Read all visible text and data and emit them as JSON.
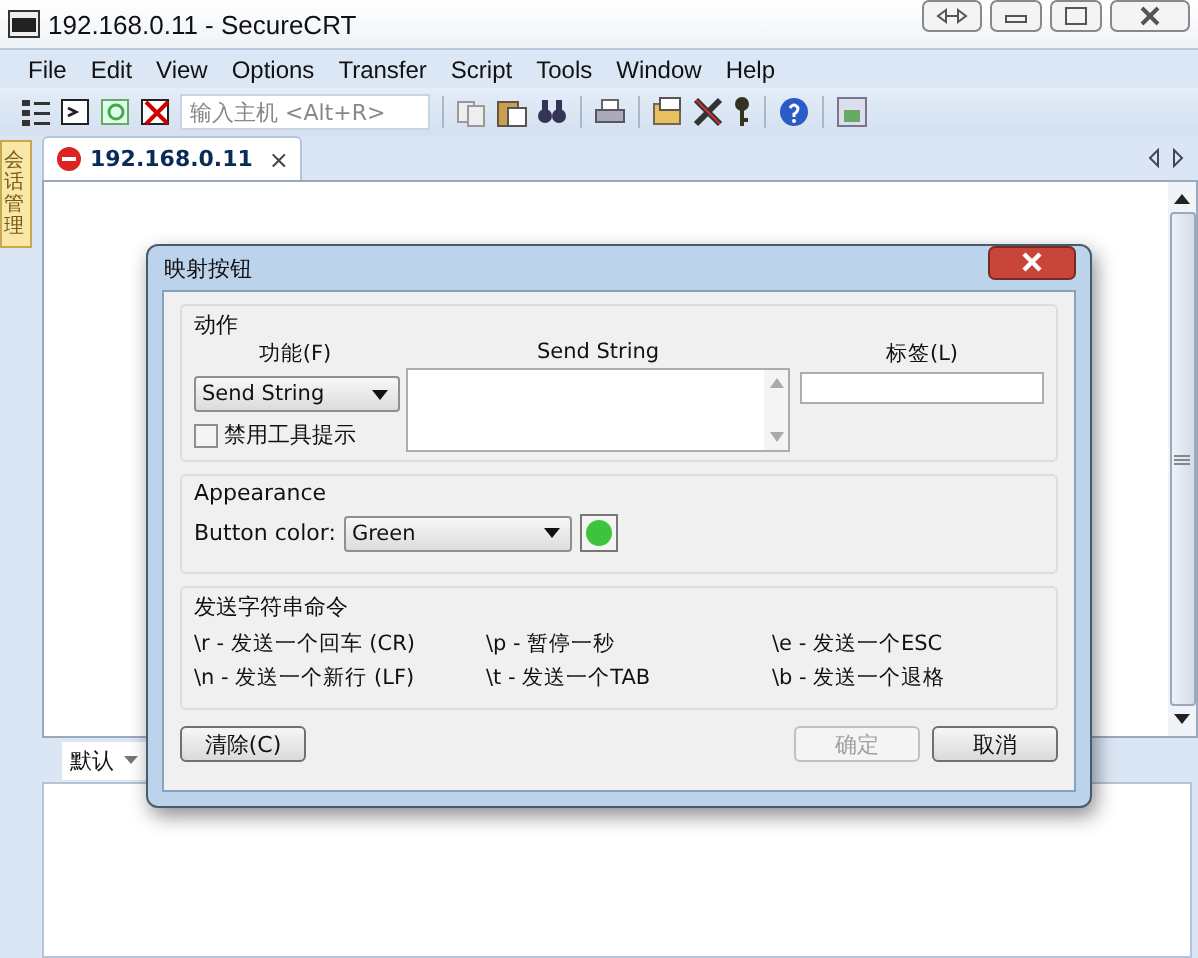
{
  "window": {
    "title": "192.168.0.11 - SecureCRT"
  },
  "menu": [
    "File",
    "Edit",
    "View",
    "Options",
    "Transfer",
    "Script",
    "Tools",
    "Window",
    "Help"
  ],
  "toolbar": {
    "host_placeholder": "输入主机 <Alt+R>"
  },
  "sidebar": {
    "label": "会话管理"
  },
  "tabs": [
    {
      "label": "192.168.0.11",
      "selected": true,
      "close": "×"
    }
  ],
  "command_bar": {
    "label": "默认"
  },
  "dialog": {
    "title": "映射按钮",
    "action": {
      "title": "动作",
      "function_label": "功能(F)",
      "function_value": "Send String",
      "string_label": "Send String",
      "tag_label": "标签(L)",
      "disable_tooltip": {
        "label": "禁用工具提示",
        "checked": false
      }
    },
    "appearance": {
      "title": "Appearance",
      "color_label": "Button color:",
      "color_value": "Green",
      "color": "#3cc43c"
    },
    "commands": {
      "title": "发送字符串命令",
      "items": [
        "\\r - 发送一个回车 (CR)",
        "\\p - 暂停一秒",
        "\\e - 发送一个ESC",
        "\\n - 发送一个新行 (LF)",
        "\\t - 发送一个TAB",
        "\\b - 发送一个退格"
      ]
    },
    "buttons": [
      {
        "label": "清除(C)",
        "disabled": false
      },
      {
        "label": "确定",
        "disabled": true
      },
      {
        "label": "取消",
        "disabled": false
      }
    ]
  }
}
